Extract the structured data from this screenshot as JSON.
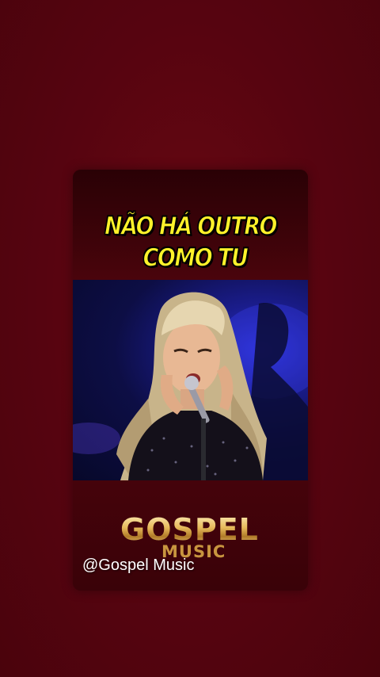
{
  "story": {
    "title_line1": "NÃO HÁ OUTRO",
    "title_line2": "COMO TU",
    "logo_main": "GOSPEL",
    "logo_sub": "MUSIC",
    "handle": "@Gospel Music"
  },
  "colors": {
    "background": "#5a0510",
    "card": "#3a0208",
    "title_text": "#fff22a",
    "logo_gold": "#e6b95a",
    "stage_light": "#2a2fd0"
  }
}
